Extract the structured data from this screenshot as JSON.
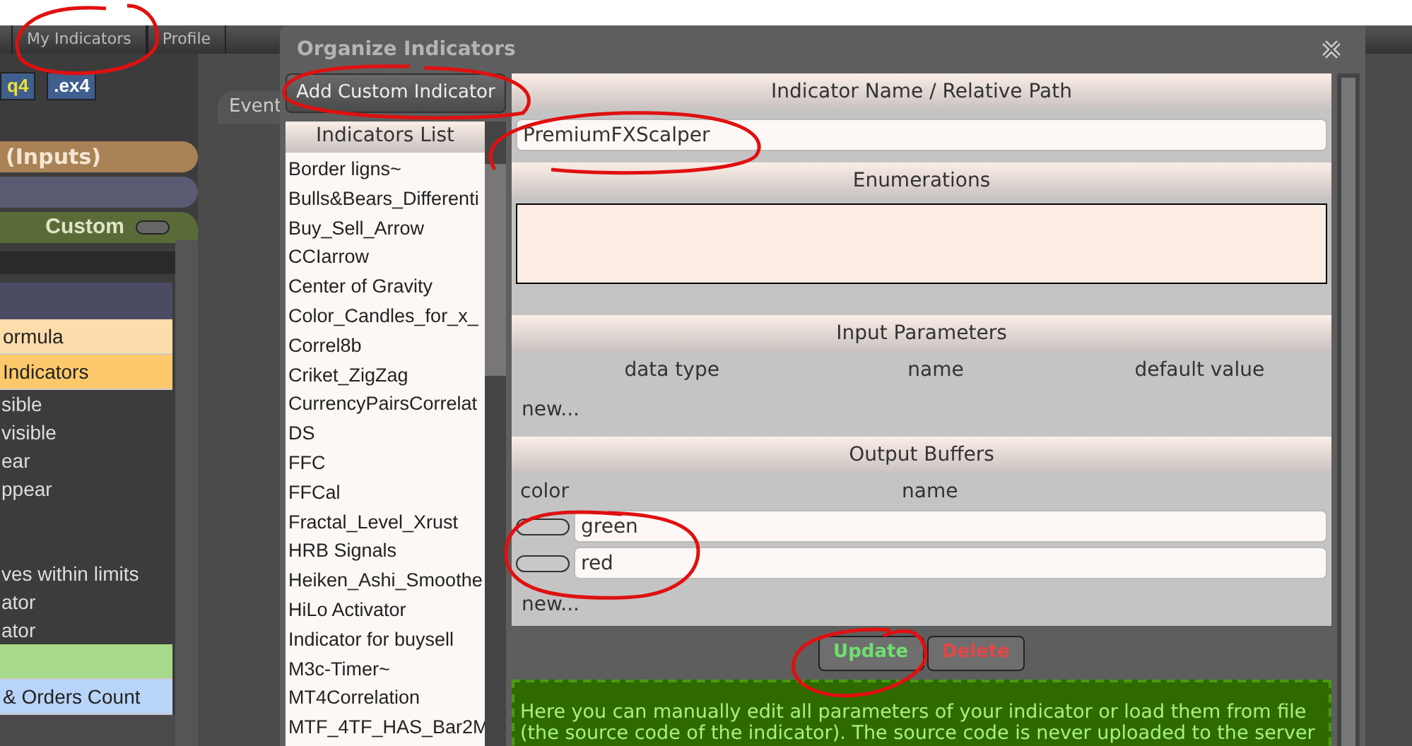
{
  "top_tabs": [
    {
      "label": "My Indicators"
    },
    {
      "label": "Profile"
    }
  ],
  "file_buttons": [
    {
      "label": "q4"
    },
    {
      "label": ".ex4"
    }
  ],
  "events_tab": {
    "label": "Event"
  },
  "left_panel": {
    "rows": [
      {
        "kind": "header",
        "label": "(Inputs)",
        "color": "#a98256"
      },
      {
        "kind": "header",
        "label": "",
        "color": "#5a5a72"
      },
      {
        "kind": "toggle",
        "label": "Custom",
        "color": "#5b6b38"
      },
      {
        "kind": "field"
      },
      {
        "kind": "band",
        "color": "#4b4b63"
      },
      {
        "kind": "item",
        "label": "ormula",
        "color": "#fcdcaa"
      },
      {
        "kind": "item",
        "label": "Indicators",
        "color": "#fbc86a"
      },
      {
        "kind": "text",
        "label": "sible"
      },
      {
        "kind": "text",
        "label": "visible"
      },
      {
        "kind": "text",
        "label": "ear"
      },
      {
        "kind": "text",
        "label": "ppear"
      },
      {
        "kind": "text",
        "label": ""
      },
      {
        "kind": "text",
        "label": ""
      },
      {
        "kind": "text",
        "label": "ves within limits"
      },
      {
        "kind": "text",
        "label": "ator"
      },
      {
        "kind": "text",
        "label": "ator"
      },
      {
        "kind": "item",
        "label": "",
        "color": "#a8d88a"
      },
      {
        "kind": "item",
        "label": "& Orders Count",
        "color": "#b8d4f8"
      }
    ]
  },
  "dialog": {
    "title": "Organize Indicators",
    "add_button": "Add Custom Indicator",
    "list_title": "Indicators List",
    "indicators": [
      "Border ligns~",
      "Bulls&Bears_Differenti",
      "Buy_Sell_Arrow",
      "CCIarrow",
      "Center of Gravity",
      "Color_Candles_for_x_",
      "Correl8b",
      "Criket_ZigZag",
      "CurrencyPairsCorrelat",
      "DS",
      "FFC",
      "FFCal",
      "Fractal_Level_Xrust",
      "HRB Signals",
      "Heiken_Ashi_Smoothe",
      "HiLo Activator",
      "Indicator for buysell",
      "M3c-Timer~",
      "MT4Correlation",
      "MTF_4TF_HAS_Bar2M"
    ],
    "name_section": {
      "title": "Indicator Name / Relative Path",
      "value": "PremiumFXScalper"
    },
    "enumerations": {
      "title": "Enumerations"
    },
    "input_parameters": {
      "title": "Input Parameters",
      "columns": [
        "data type",
        "name",
        "default value"
      ],
      "new_link": "new..."
    },
    "output_buffers": {
      "title": "Output Buffers",
      "columns": [
        "color",
        "name"
      ],
      "rows": [
        {
          "name": "green"
        },
        {
          "name": "red"
        }
      ],
      "new_link": "new..."
    },
    "buttons": [
      {
        "kind": "update",
        "label": "Update"
      },
      {
        "kind": "delete",
        "label": "Delete"
      }
    ],
    "info_lines": [
      "Here you can manually edit all parameters of your indicator or load them from file",
      "(the source code of the indicator). The source code is never uploaded to the server"
    ]
  }
}
